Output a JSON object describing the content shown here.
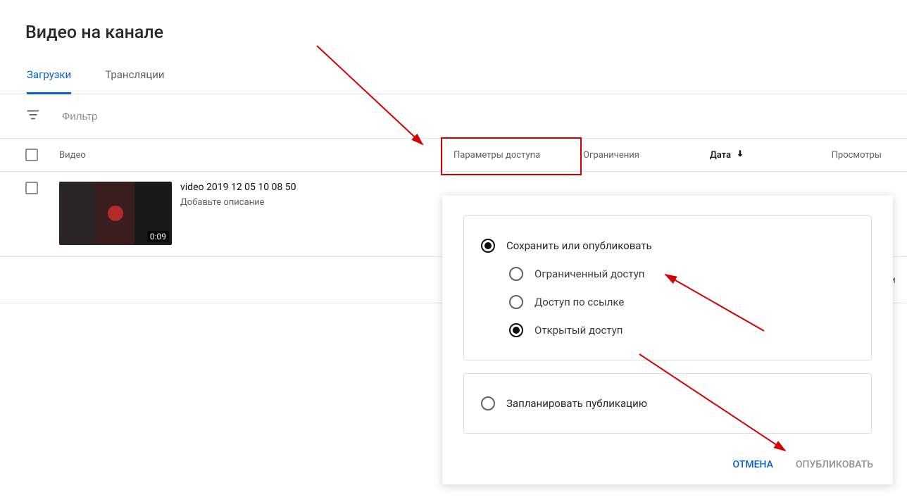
{
  "page_title": "Видео на канале",
  "tabs": {
    "uploads": "Загрузки",
    "live": "Трансляции"
  },
  "filter_placeholder": "Фильтр",
  "columns": {
    "video": "Видео",
    "access": "Параметры доступа",
    "restrict": "Ограничения",
    "date": "Дата",
    "views": "Просмотры"
  },
  "row": {
    "title": "video 2019 12 05 10 08 50",
    "desc": "Добавьте описание",
    "duration": "0:09"
  },
  "lower_right_text": "и",
  "popup": {
    "group1_label": "Сохранить или опубликовать",
    "opt_private": "Ограниченный доступ",
    "opt_link": "Доступ по ссылке",
    "opt_public": "Открытый доступ",
    "schedule_label": "Запланировать публикацию",
    "cancel": "ОТМЕНА",
    "publish": "ОПУБЛИКОВАТЬ"
  },
  "accent_blue": "#065fd4",
  "annotation_red": "#d40000"
}
